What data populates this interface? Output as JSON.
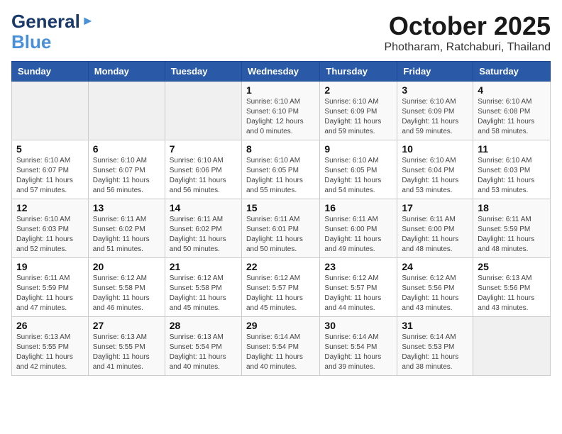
{
  "header": {
    "logo_general": "General",
    "logo_blue": "Blue",
    "month": "October 2025",
    "location": "Photharam, Ratchaburi, Thailand"
  },
  "weekdays": [
    "Sunday",
    "Monday",
    "Tuesday",
    "Wednesday",
    "Thursday",
    "Friday",
    "Saturday"
  ],
  "weeks": [
    [
      {
        "day": "",
        "info": ""
      },
      {
        "day": "",
        "info": ""
      },
      {
        "day": "",
        "info": ""
      },
      {
        "day": "1",
        "info": "Sunrise: 6:10 AM\nSunset: 6:10 PM\nDaylight: 12 hours\nand 0 minutes."
      },
      {
        "day": "2",
        "info": "Sunrise: 6:10 AM\nSunset: 6:09 PM\nDaylight: 11 hours\nand 59 minutes."
      },
      {
        "day": "3",
        "info": "Sunrise: 6:10 AM\nSunset: 6:09 PM\nDaylight: 11 hours\nand 59 minutes."
      },
      {
        "day": "4",
        "info": "Sunrise: 6:10 AM\nSunset: 6:08 PM\nDaylight: 11 hours\nand 58 minutes."
      }
    ],
    [
      {
        "day": "5",
        "info": "Sunrise: 6:10 AM\nSunset: 6:07 PM\nDaylight: 11 hours\nand 57 minutes."
      },
      {
        "day": "6",
        "info": "Sunrise: 6:10 AM\nSunset: 6:07 PM\nDaylight: 11 hours\nand 56 minutes."
      },
      {
        "day": "7",
        "info": "Sunrise: 6:10 AM\nSunset: 6:06 PM\nDaylight: 11 hours\nand 56 minutes."
      },
      {
        "day": "8",
        "info": "Sunrise: 6:10 AM\nSunset: 6:05 PM\nDaylight: 11 hours\nand 55 minutes."
      },
      {
        "day": "9",
        "info": "Sunrise: 6:10 AM\nSunset: 6:05 PM\nDaylight: 11 hours\nand 54 minutes."
      },
      {
        "day": "10",
        "info": "Sunrise: 6:10 AM\nSunset: 6:04 PM\nDaylight: 11 hours\nand 53 minutes."
      },
      {
        "day": "11",
        "info": "Sunrise: 6:10 AM\nSunset: 6:03 PM\nDaylight: 11 hours\nand 53 minutes."
      }
    ],
    [
      {
        "day": "12",
        "info": "Sunrise: 6:10 AM\nSunset: 6:03 PM\nDaylight: 11 hours\nand 52 minutes."
      },
      {
        "day": "13",
        "info": "Sunrise: 6:11 AM\nSunset: 6:02 PM\nDaylight: 11 hours\nand 51 minutes."
      },
      {
        "day": "14",
        "info": "Sunrise: 6:11 AM\nSunset: 6:02 PM\nDaylight: 11 hours\nand 50 minutes."
      },
      {
        "day": "15",
        "info": "Sunrise: 6:11 AM\nSunset: 6:01 PM\nDaylight: 11 hours\nand 50 minutes."
      },
      {
        "day": "16",
        "info": "Sunrise: 6:11 AM\nSunset: 6:00 PM\nDaylight: 11 hours\nand 49 minutes."
      },
      {
        "day": "17",
        "info": "Sunrise: 6:11 AM\nSunset: 6:00 PM\nDaylight: 11 hours\nand 48 minutes."
      },
      {
        "day": "18",
        "info": "Sunrise: 6:11 AM\nSunset: 5:59 PM\nDaylight: 11 hours\nand 48 minutes."
      }
    ],
    [
      {
        "day": "19",
        "info": "Sunrise: 6:11 AM\nSunset: 5:59 PM\nDaylight: 11 hours\nand 47 minutes."
      },
      {
        "day": "20",
        "info": "Sunrise: 6:12 AM\nSunset: 5:58 PM\nDaylight: 11 hours\nand 46 minutes."
      },
      {
        "day": "21",
        "info": "Sunrise: 6:12 AM\nSunset: 5:58 PM\nDaylight: 11 hours\nand 45 minutes."
      },
      {
        "day": "22",
        "info": "Sunrise: 6:12 AM\nSunset: 5:57 PM\nDaylight: 11 hours\nand 45 minutes."
      },
      {
        "day": "23",
        "info": "Sunrise: 6:12 AM\nSunset: 5:57 PM\nDaylight: 11 hours\nand 44 minutes."
      },
      {
        "day": "24",
        "info": "Sunrise: 6:12 AM\nSunset: 5:56 PM\nDaylight: 11 hours\nand 43 minutes."
      },
      {
        "day": "25",
        "info": "Sunrise: 6:13 AM\nSunset: 5:56 PM\nDaylight: 11 hours\nand 43 minutes."
      }
    ],
    [
      {
        "day": "26",
        "info": "Sunrise: 6:13 AM\nSunset: 5:55 PM\nDaylight: 11 hours\nand 42 minutes."
      },
      {
        "day": "27",
        "info": "Sunrise: 6:13 AM\nSunset: 5:55 PM\nDaylight: 11 hours\nand 41 minutes."
      },
      {
        "day": "28",
        "info": "Sunrise: 6:13 AM\nSunset: 5:54 PM\nDaylight: 11 hours\nand 40 minutes."
      },
      {
        "day": "29",
        "info": "Sunrise: 6:14 AM\nSunset: 5:54 PM\nDaylight: 11 hours\nand 40 minutes."
      },
      {
        "day": "30",
        "info": "Sunrise: 6:14 AM\nSunset: 5:54 PM\nDaylight: 11 hours\nand 39 minutes."
      },
      {
        "day": "31",
        "info": "Sunrise: 6:14 AM\nSunset: 5:53 PM\nDaylight: 11 hours\nand 38 minutes."
      },
      {
        "day": "",
        "info": ""
      }
    ]
  ]
}
